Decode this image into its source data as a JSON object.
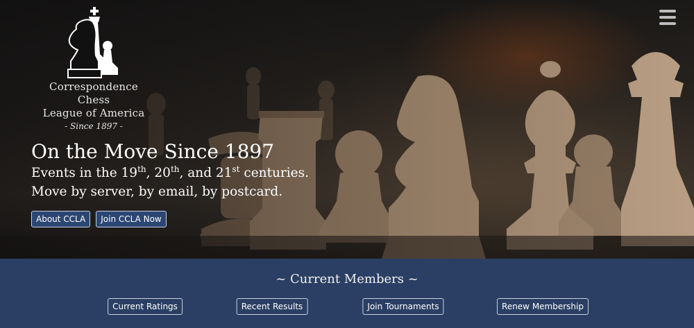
{
  "header": {
    "menu_icon": "hamburger-menu-icon",
    "logo": {
      "icon": "chess-king-knight-pawn-logo",
      "line1": "Correspondence Chess",
      "line2": "League of America",
      "since": "- Since 1897 -"
    }
  },
  "hero": {
    "title": "On the Move Since 1897",
    "events_pre": "Events in the 19",
    "sup1": "th",
    "events_mid1": ", 20",
    "sup2": "th",
    "events_mid2": ", and 21",
    "sup3": "st",
    "events_post": " centuries.",
    "move_line": "Move by server, by email, by postcard.",
    "buttons": [
      "About CCLA",
      "Join CCLA Now"
    ]
  },
  "members": {
    "heading": "~ Current Members ~",
    "links": [
      "Current Ratings",
      "Recent Results",
      "Join Tournaments",
      "Renew Membership"
    ]
  },
  "colors": {
    "band": "#2a3f63",
    "button_fill": "#2c4673",
    "button_border": "#c9d2e3",
    "text": "#ffffff"
  }
}
